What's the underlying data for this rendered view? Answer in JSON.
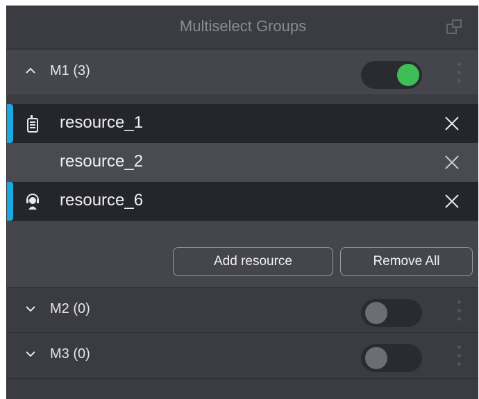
{
  "window": {
    "title": "Multiselect Groups",
    "popout_icon": "popout-window-icon"
  },
  "groups": [
    {
      "label": "M1 (3)",
      "expanded": true,
      "toggle_on": true,
      "resources": [
        {
          "name": "resource_1",
          "icon": "radio-device-icon",
          "highlighted": true
        },
        {
          "name": "resource_2",
          "icon": "",
          "highlighted": false
        },
        {
          "name": "resource_6",
          "icon": "headset-user-icon",
          "highlighted": true
        }
      ],
      "actions": {
        "add_label": "Add resource",
        "remove_label": "Remove All"
      }
    },
    {
      "label": "M2 (0)",
      "expanded": false,
      "toggle_on": false
    },
    {
      "label": "M3 (0)",
      "expanded": false,
      "toggle_on": false
    }
  ],
  "colors": {
    "accent": "#1aa9e0",
    "toggle_on": "#3fbe57",
    "panel_bg": "#3b3c42"
  }
}
